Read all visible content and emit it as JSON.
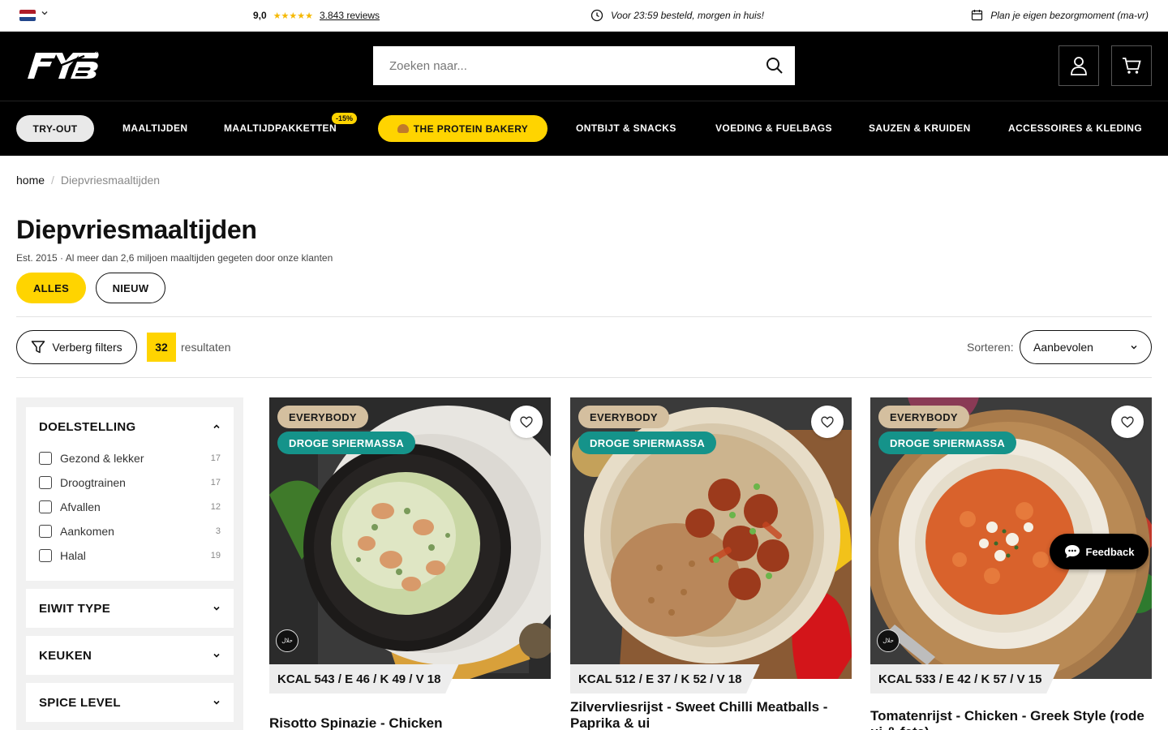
{
  "topbar": {
    "rating_score": "9,0",
    "rating_stars": "★★★★★",
    "reviews": "3.843 reviews",
    "delivery": "Voor 23:59 besteld, morgen in huis!",
    "plan": "Plan je eigen bezorgmoment (ma-vr)"
  },
  "header": {
    "search_placeholder": "Zoeken naar..."
  },
  "nav": {
    "tryout": "TRY-OUT",
    "maaltijden": "MAALTIJDEN",
    "maaltijdpakketten": "MAALTIJDPAKKETTEN",
    "discount_badge": "-15%",
    "bakery": "THE PROTEIN BAKERY",
    "ontbijt": "ONTBIJT & SNACKS",
    "voeding": "VOEDING & FUELBAGS",
    "sauzen": "SAUZEN & KRUIDEN",
    "accessoires": "ACCESSOIRES & KLEDING"
  },
  "breadcrumb": {
    "home": "home",
    "separator": "/",
    "current": "Diepvriesmaaltijden"
  },
  "page": {
    "title": "Diepvriesmaaltijden",
    "subtitle": "Est. 2015 · Al meer dan 2,6 miljoen maaltijden gegeten door onze klanten",
    "chip_alles": "ALLES",
    "chip_nieuw": "NIEUW"
  },
  "toolbar": {
    "filter_button": "Verberg filters",
    "result_count": "32",
    "result_label": "resultaten",
    "sort_label": "Sorteren:",
    "sort_value": "Aanbevolen"
  },
  "sidebar": {
    "doelstelling": {
      "title": "DOELSTELLING",
      "options": [
        {
          "label": "Gezond & lekker",
          "count": "17"
        },
        {
          "label": "Droogtrainen",
          "count": "17"
        },
        {
          "label": "Afvallen",
          "count": "12"
        },
        {
          "label": "Aankomen",
          "count": "3"
        },
        {
          "label": "Halal",
          "count": "19"
        }
      ]
    },
    "eiwit": {
      "title": "EIWIT TYPE"
    },
    "keuken": {
      "title": "KEUKEN"
    },
    "spice": {
      "title": "SPICE LEVEL"
    }
  },
  "products": [
    {
      "tag1": "EVERYBODY",
      "tag2": "DROGE SPIERMASSA",
      "macros": "KCAL 543 / E 46 / K 49 / V 18",
      "title": "Risotto Spinazie - Chicken"
    },
    {
      "tag1": "EVERYBODY",
      "tag2": "DROGE SPIERMASSA",
      "macros": "KCAL 512 / E 37 / K 52 / V 18",
      "title": "Zilvervliesrijst - Sweet Chilli Meatballs - Paprika & ui"
    },
    {
      "tag1": "EVERYBODY",
      "tag2": "DROGE SPIERMASSA",
      "macros": "KCAL 533 / E 42 / K 57 / V 15",
      "title": "Tomatenrijst - Chicken - Greek Style (rode ui & feta)"
    }
  ],
  "feedback": "Feedback",
  "colors": {
    "accent_yellow": "#ffd400",
    "teal_tag": "#15938a",
    "beige_tag": "#d4bf9f",
    "header_black": "#000000"
  },
  "icons": [
    "nl-flag-icon",
    "chevron-down-icon",
    "clock-icon",
    "calendar-icon",
    "search-icon",
    "user-icon",
    "cart-icon",
    "filter-icon",
    "heart-icon",
    "halal-icon",
    "chat-icon"
  ]
}
